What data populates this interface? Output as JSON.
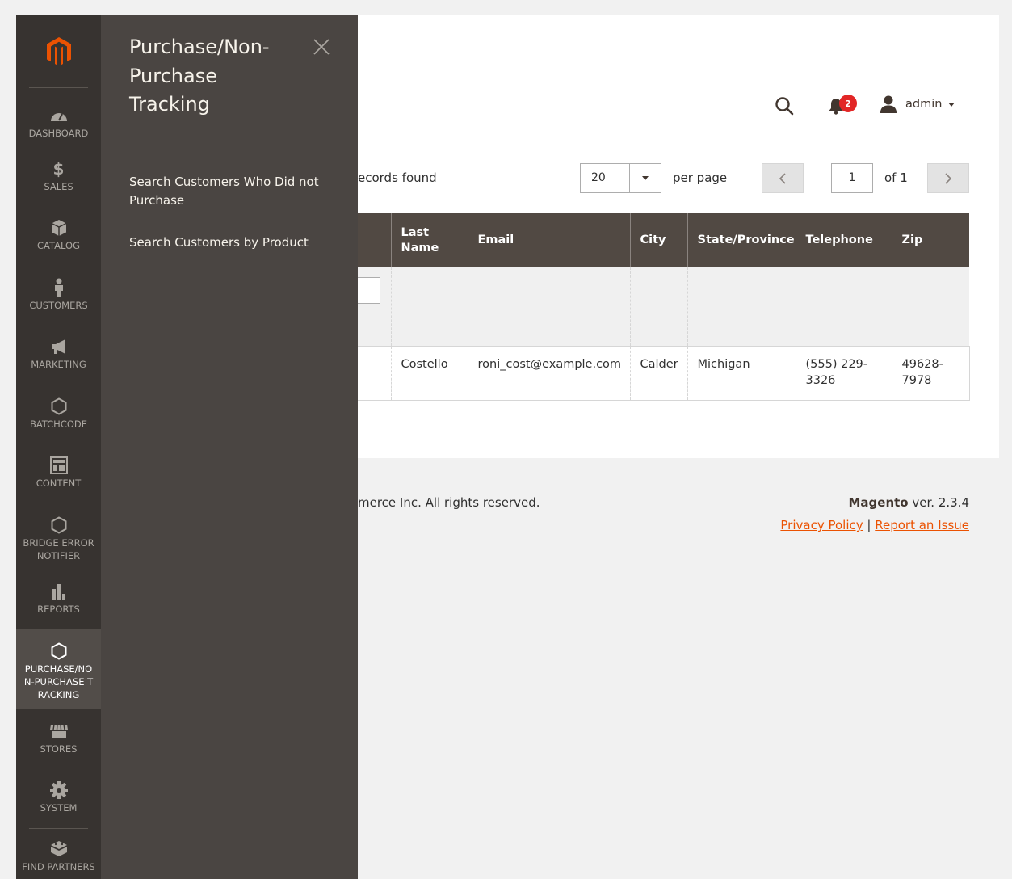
{
  "nav": {
    "items": [
      {
        "label": "DASHBOARD",
        "icon": "dashboard-icon"
      },
      {
        "label": "$",
        "sub": "SALES",
        "icon": "dollar-icon"
      },
      {
        "label": "CATALOG",
        "icon": "cube-icon"
      },
      {
        "label": "CUSTOMERS",
        "icon": "person-icon"
      },
      {
        "label": "MARKETING",
        "icon": "megaphone-icon"
      },
      {
        "label": "BATCHCODE",
        "icon": "hexagon-icon"
      },
      {
        "label": "CONTENT",
        "icon": "layout-icon"
      },
      {
        "label": "BRIDGE ERROR NOTIFIER",
        "icon": "hexagon-icon"
      },
      {
        "label": "REPORTS",
        "icon": "bar-chart-icon"
      },
      {
        "label": "PURCHASE/NON-PURCHASE TRACKING",
        "icon": "hexagon-icon"
      },
      {
        "label": "STORES",
        "icon": "storefront-icon"
      },
      {
        "label": "SYSTEM",
        "icon": "gear-icon"
      },
      {
        "label": "FIND PARTNERS",
        "icon": "blocks-icon"
      }
    ]
  },
  "flyout": {
    "title": "Purchase/Non-Purchase Tracking",
    "links": [
      "Search Customers Who Did not Purchase",
      "Search Customers by Product"
    ]
  },
  "header": {
    "notifications_count": "2",
    "user": "admin"
  },
  "toolbar": {
    "records": "ecords found",
    "per_page_value": "20",
    "per_page_label": "per page",
    "page_value": "1",
    "page_of": "of 1"
  },
  "grid": {
    "columns": [
      "Last Name",
      "Email",
      "City",
      "State/Province",
      "Telephone",
      "Zip"
    ],
    "rows": [
      {
        "last_name": "Costello",
        "email": "roni_cost@example.com",
        "city": "Calder",
        "state": "Michigan",
        "telephone": "(555) 229-3326",
        "zip": "49628-7978"
      }
    ]
  },
  "footer": {
    "copyright": "merce Inc. All rights reserved.",
    "brand": "Magento",
    "version": " ver. 2.3.4",
    "privacy": "Privacy Policy",
    "separator": "|",
    "report": "Report an Issue"
  },
  "colors": {
    "nav_bg": "#373330",
    "flyout_bg": "#4a4542",
    "accent": "#eb5202",
    "header_row": "#514943",
    "badge": "#e22626"
  }
}
